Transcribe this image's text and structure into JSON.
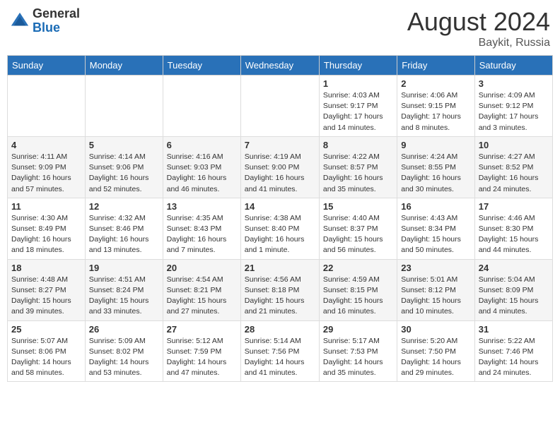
{
  "logo": {
    "general": "General",
    "blue": "Blue"
  },
  "title": {
    "month_year": "August 2024",
    "location": "Baykit, Russia"
  },
  "headers": [
    "Sunday",
    "Monday",
    "Tuesday",
    "Wednesday",
    "Thursday",
    "Friday",
    "Saturday"
  ],
  "weeks": [
    [
      {
        "day": "",
        "info": ""
      },
      {
        "day": "",
        "info": ""
      },
      {
        "day": "",
        "info": ""
      },
      {
        "day": "",
        "info": ""
      },
      {
        "day": "1",
        "info": "Sunrise: 4:03 AM\nSunset: 9:17 PM\nDaylight: 17 hours\nand 14 minutes."
      },
      {
        "day": "2",
        "info": "Sunrise: 4:06 AM\nSunset: 9:15 PM\nDaylight: 17 hours\nand 8 minutes."
      },
      {
        "day": "3",
        "info": "Sunrise: 4:09 AM\nSunset: 9:12 PM\nDaylight: 17 hours\nand 3 minutes."
      }
    ],
    [
      {
        "day": "4",
        "info": "Sunrise: 4:11 AM\nSunset: 9:09 PM\nDaylight: 16 hours\nand 57 minutes."
      },
      {
        "day": "5",
        "info": "Sunrise: 4:14 AM\nSunset: 9:06 PM\nDaylight: 16 hours\nand 52 minutes."
      },
      {
        "day": "6",
        "info": "Sunrise: 4:16 AM\nSunset: 9:03 PM\nDaylight: 16 hours\nand 46 minutes."
      },
      {
        "day": "7",
        "info": "Sunrise: 4:19 AM\nSunset: 9:00 PM\nDaylight: 16 hours\nand 41 minutes."
      },
      {
        "day": "8",
        "info": "Sunrise: 4:22 AM\nSunset: 8:57 PM\nDaylight: 16 hours\nand 35 minutes."
      },
      {
        "day": "9",
        "info": "Sunrise: 4:24 AM\nSunset: 8:55 PM\nDaylight: 16 hours\nand 30 minutes."
      },
      {
        "day": "10",
        "info": "Sunrise: 4:27 AM\nSunset: 8:52 PM\nDaylight: 16 hours\nand 24 minutes."
      }
    ],
    [
      {
        "day": "11",
        "info": "Sunrise: 4:30 AM\nSunset: 8:49 PM\nDaylight: 16 hours\nand 18 minutes."
      },
      {
        "day": "12",
        "info": "Sunrise: 4:32 AM\nSunset: 8:46 PM\nDaylight: 16 hours\nand 13 minutes."
      },
      {
        "day": "13",
        "info": "Sunrise: 4:35 AM\nSunset: 8:43 PM\nDaylight: 16 hours\nand 7 minutes."
      },
      {
        "day": "14",
        "info": "Sunrise: 4:38 AM\nSunset: 8:40 PM\nDaylight: 16 hours\nand 1 minute."
      },
      {
        "day": "15",
        "info": "Sunrise: 4:40 AM\nSunset: 8:37 PM\nDaylight: 15 hours\nand 56 minutes."
      },
      {
        "day": "16",
        "info": "Sunrise: 4:43 AM\nSunset: 8:34 PM\nDaylight: 15 hours\nand 50 minutes."
      },
      {
        "day": "17",
        "info": "Sunrise: 4:46 AM\nSunset: 8:30 PM\nDaylight: 15 hours\nand 44 minutes."
      }
    ],
    [
      {
        "day": "18",
        "info": "Sunrise: 4:48 AM\nSunset: 8:27 PM\nDaylight: 15 hours\nand 39 minutes."
      },
      {
        "day": "19",
        "info": "Sunrise: 4:51 AM\nSunset: 8:24 PM\nDaylight: 15 hours\nand 33 minutes."
      },
      {
        "day": "20",
        "info": "Sunrise: 4:54 AM\nSunset: 8:21 PM\nDaylight: 15 hours\nand 27 minutes."
      },
      {
        "day": "21",
        "info": "Sunrise: 4:56 AM\nSunset: 8:18 PM\nDaylight: 15 hours\nand 21 minutes."
      },
      {
        "day": "22",
        "info": "Sunrise: 4:59 AM\nSunset: 8:15 PM\nDaylight: 15 hours\nand 16 minutes."
      },
      {
        "day": "23",
        "info": "Sunrise: 5:01 AM\nSunset: 8:12 PM\nDaylight: 15 hours\nand 10 minutes."
      },
      {
        "day": "24",
        "info": "Sunrise: 5:04 AM\nSunset: 8:09 PM\nDaylight: 15 hours\nand 4 minutes."
      }
    ],
    [
      {
        "day": "25",
        "info": "Sunrise: 5:07 AM\nSunset: 8:06 PM\nDaylight: 14 hours\nand 58 minutes."
      },
      {
        "day": "26",
        "info": "Sunrise: 5:09 AM\nSunset: 8:02 PM\nDaylight: 14 hours\nand 53 minutes."
      },
      {
        "day": "27",
        "info": "Sunrise: 5:12 AM\nSunset: 7:59 PM\nDaylight: 14 hours\nand 47 minutes."
      },
      {
        "day": "28",
        "info": "Sunrise: 5:14 AM\nSunset: 7:56 PM\nDaylight: 14 hours\nand 41 minutes."
      },
      {
        "day": "29",
        "info": "Sunrise: 5:17 AM\nSunset: 7:53 PM\nDaylight: 14 hours\nand 35 minutes."
      },
      {
        "day": "30",
        "info": "Sunrise: 5:20 AM\nSunset: 7:50 PM\nDaylight: 14 hours\nand 29 minutes."
      },
      {
        "day": "31",
        "info": "Sunrise: 5:22 AM\nSunset: 7:46 PM\nDaylight: 14 hours\nand 24 minutes."
      }
    ]
  ]
}
